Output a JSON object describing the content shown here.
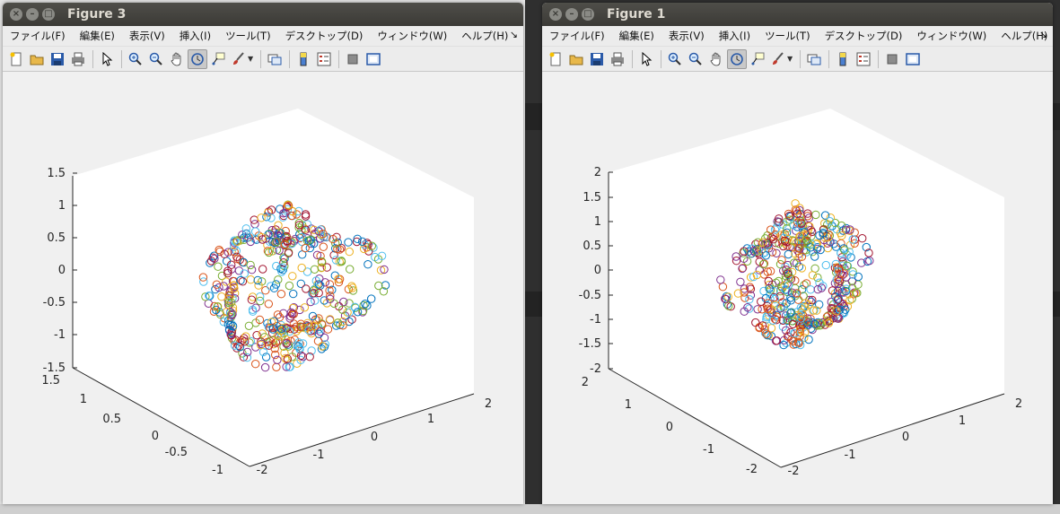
{
  "windows": [
    {
      "id": "left",
      "title": "Figure 3",
      "zticks": [
        "1.5",
        "1",
        "0.5",
        "0",
        "-0.5",
        "-1",
        "-1.5"
      ],
      "yticks": [
        "1.5",
        "1",
        "0.5",
        "0",
        "-0.5",
        "-1"
      ],
      "xticks": [
        "-2",
        "-1",
        "0",
        "1",
        "2"
      ]
    },
    {
      "id": "right",
      "title": "Figure 1",
      "zticks": [
        "2",
        "1.5",
        "1",
        "0.5",
        "0",
        "-0.5",
        "-1",
        "-1.5",
        "-2"
      ],
      "yticks": [
        "2",
        "1",
        "0",
        "-1",
        "-2"
      ],
      "xticks": [
        "-2",
        "-1",
        "0",
        "1",
        "2"
      ]
    }
  ],
  "menu": [
    "ファイル(F)",
    "編集(E)",
    "表示(V)",
    "挿入(I)",
    "ツール(T)",
    "デスクトップ(D)",
    "ウィンドウ(W)",
    "ヘルプ(H)"
  ],
  "menu_overflow": "↘",
  "toolbar_icons": [
    "new-figure-icon",
    "open-file-icon",
    "save-icon",
    "print-icon",
    "pointer-icon",
    "zoom-in-icon",
    "zoom-out-icon",
    "pan-hand-icon",
    "rotate-3d-icon",
    "data-cursor-icon",
    "brush-icon",
    "link-plot-icon",
    "colorbar-icon",
    "legend-icon",
    "hide-plot-tools-icon",
    "show-plot-tools-icon"
  ],
  "marker_colors": [
    "#0072BD",
    "#D95319",
    "#EDB120",
    "#7E2F8E",
    "#77AC30",
    "#4DBEEE",
    "#A2142F"
  ]
}
